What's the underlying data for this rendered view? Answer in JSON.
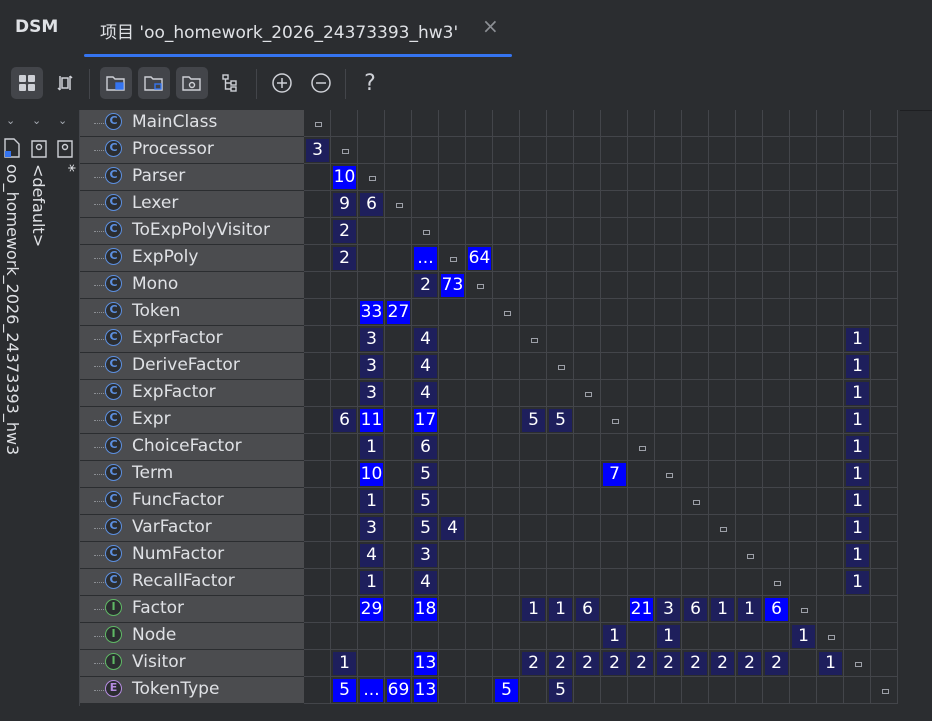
{
  "header": {
    "tool_title": "DSM",
    "tab_label": "项目 'oo_homework_2026_24373393_hw3'",
    "close_glyph": "×"
  },
  "toolbar": {
    "buttons": [
      {
        "name": "matrix-view-icon",
        "active": true
      },
      {
        "name": "flip-icon",
        "active": false
      },
      {
        "name": "folder-group-icon",
        "active": true
      },
      {
        "name": "folder-package-icon",
        "active": true
      },
      {
        "name": "folder-module-icon",
        "active": true
      },
      {
        "name": "hierarchy-icon",
        "active": false
      },
      {
        "name": "zoom-in-icon",
        "active": false
      },
      {
        "name": "zoom-out-icon",
        "active": false
      },
      {
        "name": "help-icon",
        "active": false,
        "text": "?"
      }
    ]
  },
  "tree": {
    "project": "oo_homework_2026_24373393_hw3",
    "package": "<default>",
    "star": "*"
  },
  "rows": [
    {
      "label": "MainClass",
      "kind": "main"
    },
    {
      "label": "Processor",
      "kind": "class"
    },
    {
      "label": "Parser",
      "kind": "class"
    },
    {
      "label": "Lexer",
      "kind": "class"
    },
    {
      "label": "ToExpPolyVisitor",
      "kind": "class"
    },
    {
      "label": "ExpPoly",
      "kind": "class"
    },
    {
      "label": "Mono",
      "kind": "class"
    },
    {
      "label": "Token",
      "kind": "class"
    },
    {
      "label": "ExprFactor",
      "kind": "class"
    },
    {
      "label": "DeriveFactor",
      "kind": "class"
    },
    {
      "label": "ExpFactor",
      "kind": "class"
    },
    {
      "label": "Expr",
      "kind": "class"
    },
    {
      "label": "ChoiceFactor",
      "kind": "class"
    },
    {
      "label": "Term",
      "kind": "class"
    },
    {
      "label": "FuncFactor",
      "kind": "class"
    },
    {
      "label": "VarFactor",
      "kind": "class"
    },
    {
      "label": "NumFactor",
      "kind": "class"
    },
    {
      "label": "RecallFactor",
      "kind": "class"
    },
    {
      "label": "Factor",
      "kind": "interface"
    },
    {
      "label": "Node",
      "kind": "interface"
    },
    {
      "label": "Visitor",
      "kind": "interface"
    },
    {
      "label": "TokenType",
      "kind": "enum"
    }
  ],
  "icon_letters": {
    "main": "C",
    "class": "C",
    "interface": "I",
    "enum": "E"
  },
  "icon_colors": {
    "main": "#5c8fdf",
    "class": "#5c8fdf",
    "interface": "#5fb865",
    "enum": "#b48be0"
  },
  "cell_colors": {
    "bright": "#0000ff",
    "dark": "#1e1f5c"
  },
  "matrix": [
    [],
    [
      [
        0,
        "3",
        0
      ]
    ],
    [
      [
        1,
        "10",
        1
      ]
    ],
    [
      [
        1,
        "9",
        0
      ],
      [
        2,
        "6",
        0
      ]
    ],
    [
      [
        1,
        "2",
        0
      ]
    ],
    [
      [
        1,
        "2",
        0
      ],
      [
        4,
        "...",
        1
      ],
      [
        6,
        "64",
        1
      ]
    ],
    [
      [
        4,
        "2",
        0
      ],
      [
        5,
        "73",
        1
      ]
    ],
    [
      [
        2,
        "33",
        1
      ],
      [
        3,
        "27",
        1
      ]
    ],
    [
      [
        2,
        "3",
        0
      ],
      [
        4,
        "4",
        0
      ],
      [
        20,
        "1",
        0
      ]
    ],
    [
      [
        2,
        "3",
        0
      ],
      [
        4,
        "4",
        0
      ],
      [
        20,
        "1",
        0
      ]
    ],
    [
      [
        2,
        "3",
        0
      ],
      [
        4,
        "4",
        0
      ],
      [
        20,
        "1",
        0
      ]
    ],
    [
      [
        1,
        "6",
        0
      ],
      [
        2,
        "11",
        1
      ],
      [
        4,
        "17",
        1
      ],
      [
        8,
        "5",
        0
      ],
      [
        9,
        "5",
        0
      ],
      [
        20,
        "1",
        0
      ]
    ],
    [
      [
        2,
        "1",
        0
      ],
      [
        4,
        "6",
        0
      ],
      [
        20,
        "1",
        0
      ]
    ],
    [
      [
        2,
        "10",
        1
      ],
      [
        4,
        "5",
        0
      ],
      [
        11,
        "7",
        1
      ],
      [
        20,
        "1",
        0
      ]
    ],
    [
      [
        2,
        "1",
        0
      ],
      [
        4,
        "5",
        0
      ],
      [
        20,
        "1",
        0
      ]
    ],
    [
      [
        2,
        "3",
        0
      ],
      [
        4,
        "5",
        0
      ],
      [
        5,
        "4",
        0
      ],
      [
        20,
        "1",
        0
      ]
    ],
    [
      [
        2,
        "4",
        0
      ],
      [
        4,
        "3",
        0
      ],
      [
        20,
        "1",
        0
      ]
    ],
    [
      [
        2,
        "1",
        0
      ],
      [
        4,
        "4",
        0
      ],
      [
        20,
        "1",
        0
      ]
    ],
    [
      [
        2,
        "29",
        1
      ],
      [
        4,
        "18",
        1
      ],
      [
        8,
        "1",
        0
      ],
      [
        9,
        "1",
        0
      ],
      [
        10,
        "6",
        0
      ],
      [
        12,
        "21",
        1
      ],
      [
        13,
        "3",
        0
      ],
      [
        14,
        "6",
        0
      ],
      [
        15,
        "1",
        0
      ],
      [
        16,
        "1",
        0
      ],
      [
        17,
        "6",
        1
      ]
    ],
    [
      [
        11,
        "1",
        0
      ],
      [
        13,
        "1",
        0
      ],
      [
        18,
        "1",
        0
      ]
    ],
    [
      [
        1,
        "1",
        0
      ],
      [
        4,
        "13",
        1
      ],
      [
        8,
        "2",
        0
      ],
      [
        9,
        "2",
        0
      ],
      [
        10,
        "2",
        0
      ],
      [
        11,
        "2",
        0
      ],
      [
        12,
        "2",
        0
      ],
      [
        13,
        "2",
        0
      ],
      [
        14,
        "2",
        0
      ],
      [
        15,
        "2",
        0
      ],
      [
        16,
        "2",
        0
      ],
      [
        17,
        "2",
        0
      ],
      [
        19,
        "1",
        0
      ]
    ],
    [
      [
        1,
        "5",
        1
      ],
      [
        2,
        "...",
        1
      ],
      [
        3,
        "69",
        1
      ],
      [
        4,
        "13",
        1
      ],
      [
        7,
        "5",
        1
      ],
      [
        9,
        "5",
        0
      ]
    ]
  ]
}
